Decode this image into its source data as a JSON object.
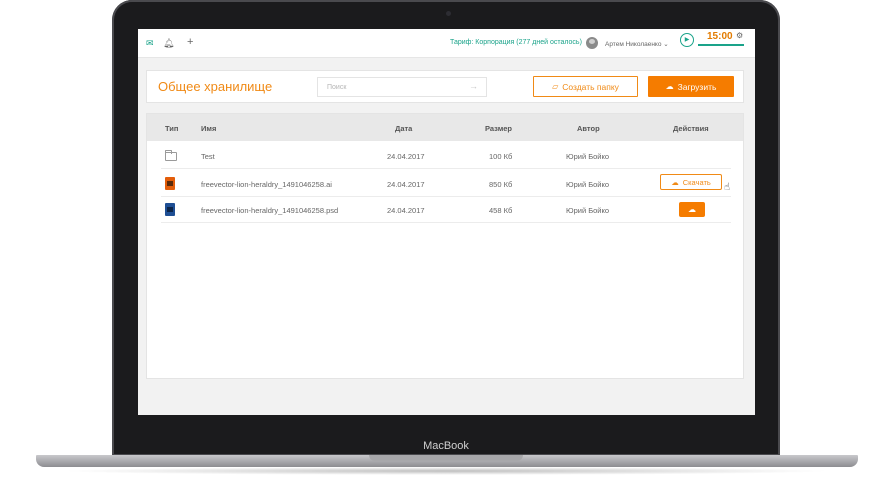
{
  "device": {
    "brand": "MacBook"
  },
  "topbar": {
    "tariff": "Тариф: Корпорация (277 дней осталось)",
    "user_name": "Артем Николаенко",
    "timer": "15:00",
    "icons": {
      "mail": "mail-icon",
      "bell": "bell-icon",
      "plus": "plus-icon",
      "play": "play-icon",
      "gear": "gear-icon"
    }
  },
  "header": {
    "title": "Общее хранилище",
    "search_placeholder": "Поиск",
    "create_folder_label": "Создать папку",
    "upload_label": "Загрузить"
  },
  "table": {
    "columns": [
      "Тип",
      "Имя",
      "Дата",
      "Размер",
      "Автор",
      "Действия"
    ],
    "rows": [
      {
        "type": "folder",
        "name": "Test",
        "date": "24.04.2017",
        "size": "100 Кб",
        "author": "Юрий Бойко"
      },
      {
        "type": "ai",
        "name": "freevector-lion-heraldry_1491046258.ai",
        "date": "24.04.2017",
        "size": "850 Кб",
        "author": "Юрий Бойко",
        "action_label": "Скачать"
      },
      {
        "type": "psd",
        "name": "freevector-lion-heraldry_1491046258.psd",
        "date": "24.04.2017",
        "size": "458 Кб",
        "author": "Юрий Бойко"
      }
    ]
  },
  "colors": {
    "accent": "#f57c00",
    "accent_text": "#f08a16",
    "green": "#1aa38a"
  }
}
